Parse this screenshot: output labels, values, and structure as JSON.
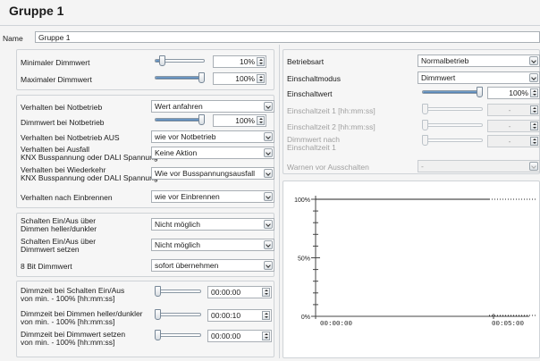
{
  "title": "Gruppe 1",
  "name_label": "Name",
  "name_value": "Gruppe 1",
  "left": {
    "min_dimm": {
      "label": "Minimaler Dimmwert",
      "value": "10%",
      "level": 0.1
    },
    "max_dimm": {
      "label": "Maximaler Dimmwert",
      "value": "100%",
      "level": 1.0
    },
    "notbetrieb": {
      "label": "Verhalten bei Notbetrieb",
      "value": "Wert anfahren"
    },
    "dimm_notbetrieb": {
      "label": "Dimmwert bei Notbetrieb",
      "value": "100%",
      "level": 1.0
    },
    "notbetrieb_aus": {
      "label": "Verhalten bei Notbetrieb AUS",
      "value": "wie vor Notbetrieb"
    },
    "ausfall": {
      "label1": "Verhalten bei Ausfall",
      "label2": "KNX Busspannung oder DALI Spannung",
      "value": "Keine Aktion"
    },
    "wiederkehr": {
      "label1": "Verhalten bei Wiederkehr",
      "label2": "KNX Busspannung oder DALI Spannung",
      "value": "Wie vor Busspannungsausfall"
    },
    "einbrennen": {
      "label": "Verhalten nach Einbrennen",
      "value": "wie vor Einbrennen"
    },
    "schalten_dimmen": {
      "label1": "Schalten Ein/Aus über",
      "label2": "Dimmen heller/dunkler",
      "value": "Nicht möglich"
    },
    "schalten_dimmwert": {
      "label1": "Schalten Ein/Aus über",
      "label2": "Dimmwert setzen",
      "value": "Nicht möglich"
    },
    "bit8": {
      "label": "8 Bit Dimmwert",
      "value": "sofort übernehmen"
    },
    "dz_schalten": {
      "label1": "Dimmzeit bei Schalten Ein/Aus",
      "label2": "von min. - 100% [hh:mm:ss]",
      "value": "00:00:00",
      "level": 0.0
    },
    "dz_dimmen": {
      "label1": "Dimmzeit bei Dimmen heller/dunkler",
      "label2": "von min. - 100% [hh:mm:ss]",
      "value": "00:00:10",
      "level": 0.0
    },
    "dz_setzen": {
      "label1": "Dimmzeit bei Dimmwert setzen",
      "label2": "von min. - 100% [hh:mm:ss]",
      "value": "00:00:00",
      "level": 0.0
    }
  },
  "right": {
    "betriebsart": {
      "label": "Betriebsart",
      "value": "Normalbetrieb"
    },
    "einschaltmodus": {
      "label": "Einschaltmodus",
      "value": "Dimmwert"
    },
    "einschaltwert": {
      "label": "Einschaltwert",
      "value": "100%",
      "level": 1.0
    },
    "ez1": {
      "label": "Einschaltzeit 1 [hh:mm:ss]",
      "value": "-"
    },
    "ez2": {
      "label": "Einschaltzeit 2 [hh:mm:ss]",
      "value": "-"
    },
    "dimm_nach": {
      "label1": "Dimmwert nach",
      "label2": "Einschaltzeit 1",
      "value": "-"
    },
    "warnen": {
      "label": "Warnen vor Ausschalten",
      "value": "-"
    }
  },
  "chart_data": {
    "type": "line",
    "x": [
      "00:00:00",
      "00:05:00"
    ],
    "y_ticks": [
      "100%",
      "50%",
      "0%"
    ],
    "x_ticks": [
      "00:00:00",
      "00:05:00"
    ],
    "ylim": [
      0,
      100
    ],
    "series": [
      {
        "values": [
          100,
          100
        ]
      }
    ]
  },
  "colors": {
    "accent": "#4a79ac",
    "border": "#a9afb5"
  }
}
